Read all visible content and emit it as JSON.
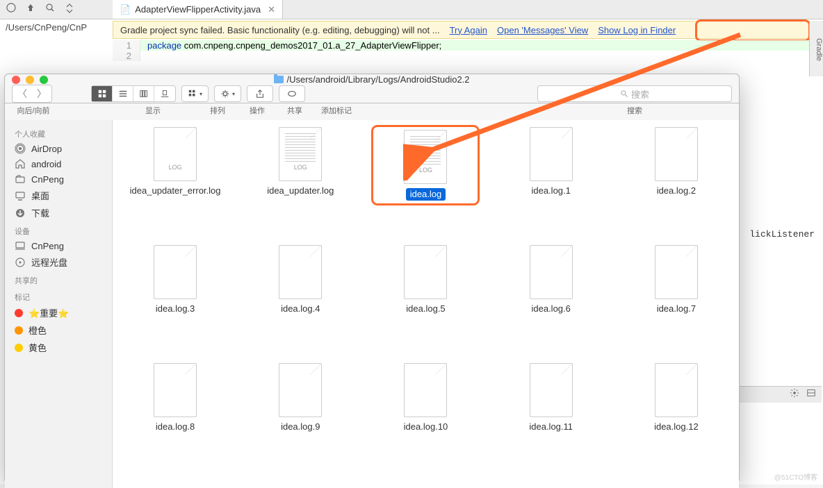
{
  "ide": {
    "tab_title": "AdapterViewFlipperActivity.java",
    "breadcrumb": "/Users/CnPeng/CnP",
    "warning_text": "Gradle project sync failed. Basic functionality (e.g. editing, debugging) will not ...",
    "try_again": "Try Again",
    "open_messages": "Open 'Messages' View",
    "show_log": "Show Log in Finder",
    "line_number": "1",
    "line_number2": "2",
    "code_kw": "package",
    "code_rest": " com.cnpeng.cnpeng_demos2017_01.a_27_AdapterViewFlipper;",
    "snippet_right": "lickListener",
    "side_gradle": "Gradle"
  },
  "finder": {
    "title_path": "/Users/android/Library/Logs/AndroidStudio2.2",
    "nav_back_forward": "向后/向前",
    "view_label": "显示",
    "arrange_label": "排列",
    "action_label": "操作",
    "share_label": "共享",
    "tags_label": "添加标记",
    "search_label": "搜索",
    "search_placeholder": "搜索",
    "sidebar": {
      "favorites": "个人收藏",
      "airdrop": "AirDrop",
      "android": "android",
      "cnpeng": "CnPeng",
      "desktop": "桌面",
      "downloads": "下载",
      "devices": "设备",
      "dev_cnpeng": "CnPeng",
      "remote_disc": "远程光盘",
      "shared": "共享的",
      "tags": "标记",
      "tag_important": "⭐️重要⭐️",
      "tag_orange": "橙色",
      "tag_yellow": "黄色"
    },
    "files": [
      {
        "name": "idea_updater_error.log",
        "type": "log"
      },
      {
        "name": "idea_updater.log",
        "type": "text"
      },
      {
        "name": "idea.log",
        "type": "text",
        "selected": true,
        "highlight": true
      },
      {
        "name": "idea.log.1",
        "type": "plain"
      },
      {
        "name": "idea.log.2",
        "type": "plain"
      },
      {
        "name": "idea.log.3",
        "type": "plain"
      },
      {
        "name": "idea.log.4",
        "type": "plain"
      },
      {
        "name": "idea.log.5",
        "type": "plain"
      },
      {
        "name": "idea.log.6",
        "type": "plain"
      },
      {
        "name": "idea.log.7",
        "type": "plain"
      },
      {
        "name": "idea.log.8",
        "type": "plain"
      },
      {
        "name": "idea.log.9",
        "type": "plain"
      },
      {
        "name": "idea.log.10",
        "type": "plain"
      },
      {
        "name": "idea.log.11",
        "type": "plain"
      },
      {
        "name": "idea.log.12",
        "type": "plain"
      }
    ]
  },
  "icon_text": {
    "log": "LOG"
  },
  "watermark": "@51CTO博客"
}
